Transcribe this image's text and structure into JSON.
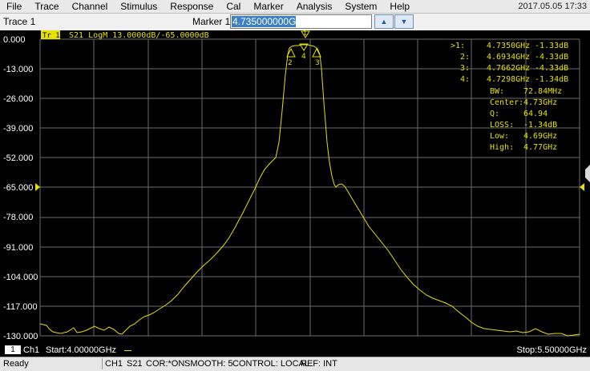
{
  "menu": [
    "File",
    "Trace",
    "Channel",
    "Stimulus",
    "Response",
    "Cal",
    "Marker",
    "Analysis",
    "System",
    "Help"
  ],
  "datetime": "2017.05.05 17:33",
  "toolbar": {
    "trace_label": "Trace 1",
    "marker_label": "Marker 1",
    "marker_value": "4.735000000GHz",
    "up_icon": "up-arrow-icon",
    "down_icon": "down-arrow-icon"
  },
  "trace_header": {
    "badge": "Tr 1",
    "text": "S21 LogM 13.0000dB/-65.0000dB"
  },
  "y_axis": [
    "0.000",
    "-13.000",
    "-26.000",
    "-39.000",
    "-52.000",
    "-65.000",
    "-78.000",
    "-91.000",
    "-104.000",
    "-117.000",
    "-130.000"
  ],
  "markers": [
    {
      "label": ">1:",
      "freq": "4.7350GHz",
      "val": "-1.33dB"
    },
    {
      "label": "2:",
      "freq": "4.6934GHz",
      "val": "-4.33dB"
    },
    {
      "label": "3:",
      "freq": "4.7662GHz",
      "val": "-4.33dB"
    },
    {
      "label": "4:",
      "freq": "4.7298GHz",
      "val": "-1.34dB"
    }
  ],
  "stats": [
    {
      "k": "BW:",
      "v": "72.84MHz"
    },
    {
      "k": "Center:",
      "v": "4.73GHz"
    },
    {
      "k": "Q:",
      "v": "64.94"
    },
    {
      "k": "LOSS:",
      "v": "-1.34dB"
    },
    {
      "k": "Low:",
      "v": "4.69GHz"
    },
    {
      "k": "High:",
      "v": "4.77GHz"
    }
  ],
  "footer": {
    "ch_num": "1",
    "ch_label": "Ch1",
    "start": "Start:4.00000GHz",
    "stop": "Stop:5.50000GHz"
  },
  "status": {
    "ready": "Ready",
    "ch": "CH1",
    "param": "S21",
    "cor": "COR:*ON",
    "smooth": "SMOOTH: 5",
    "control": "CONTROL: LOCAL",
    "ref": "REF: INT"
  },
  "colors": {
    "trace": "#e6e000",
    "grid": "#6b6b6b",
    "background": "#000000"
  }
}
